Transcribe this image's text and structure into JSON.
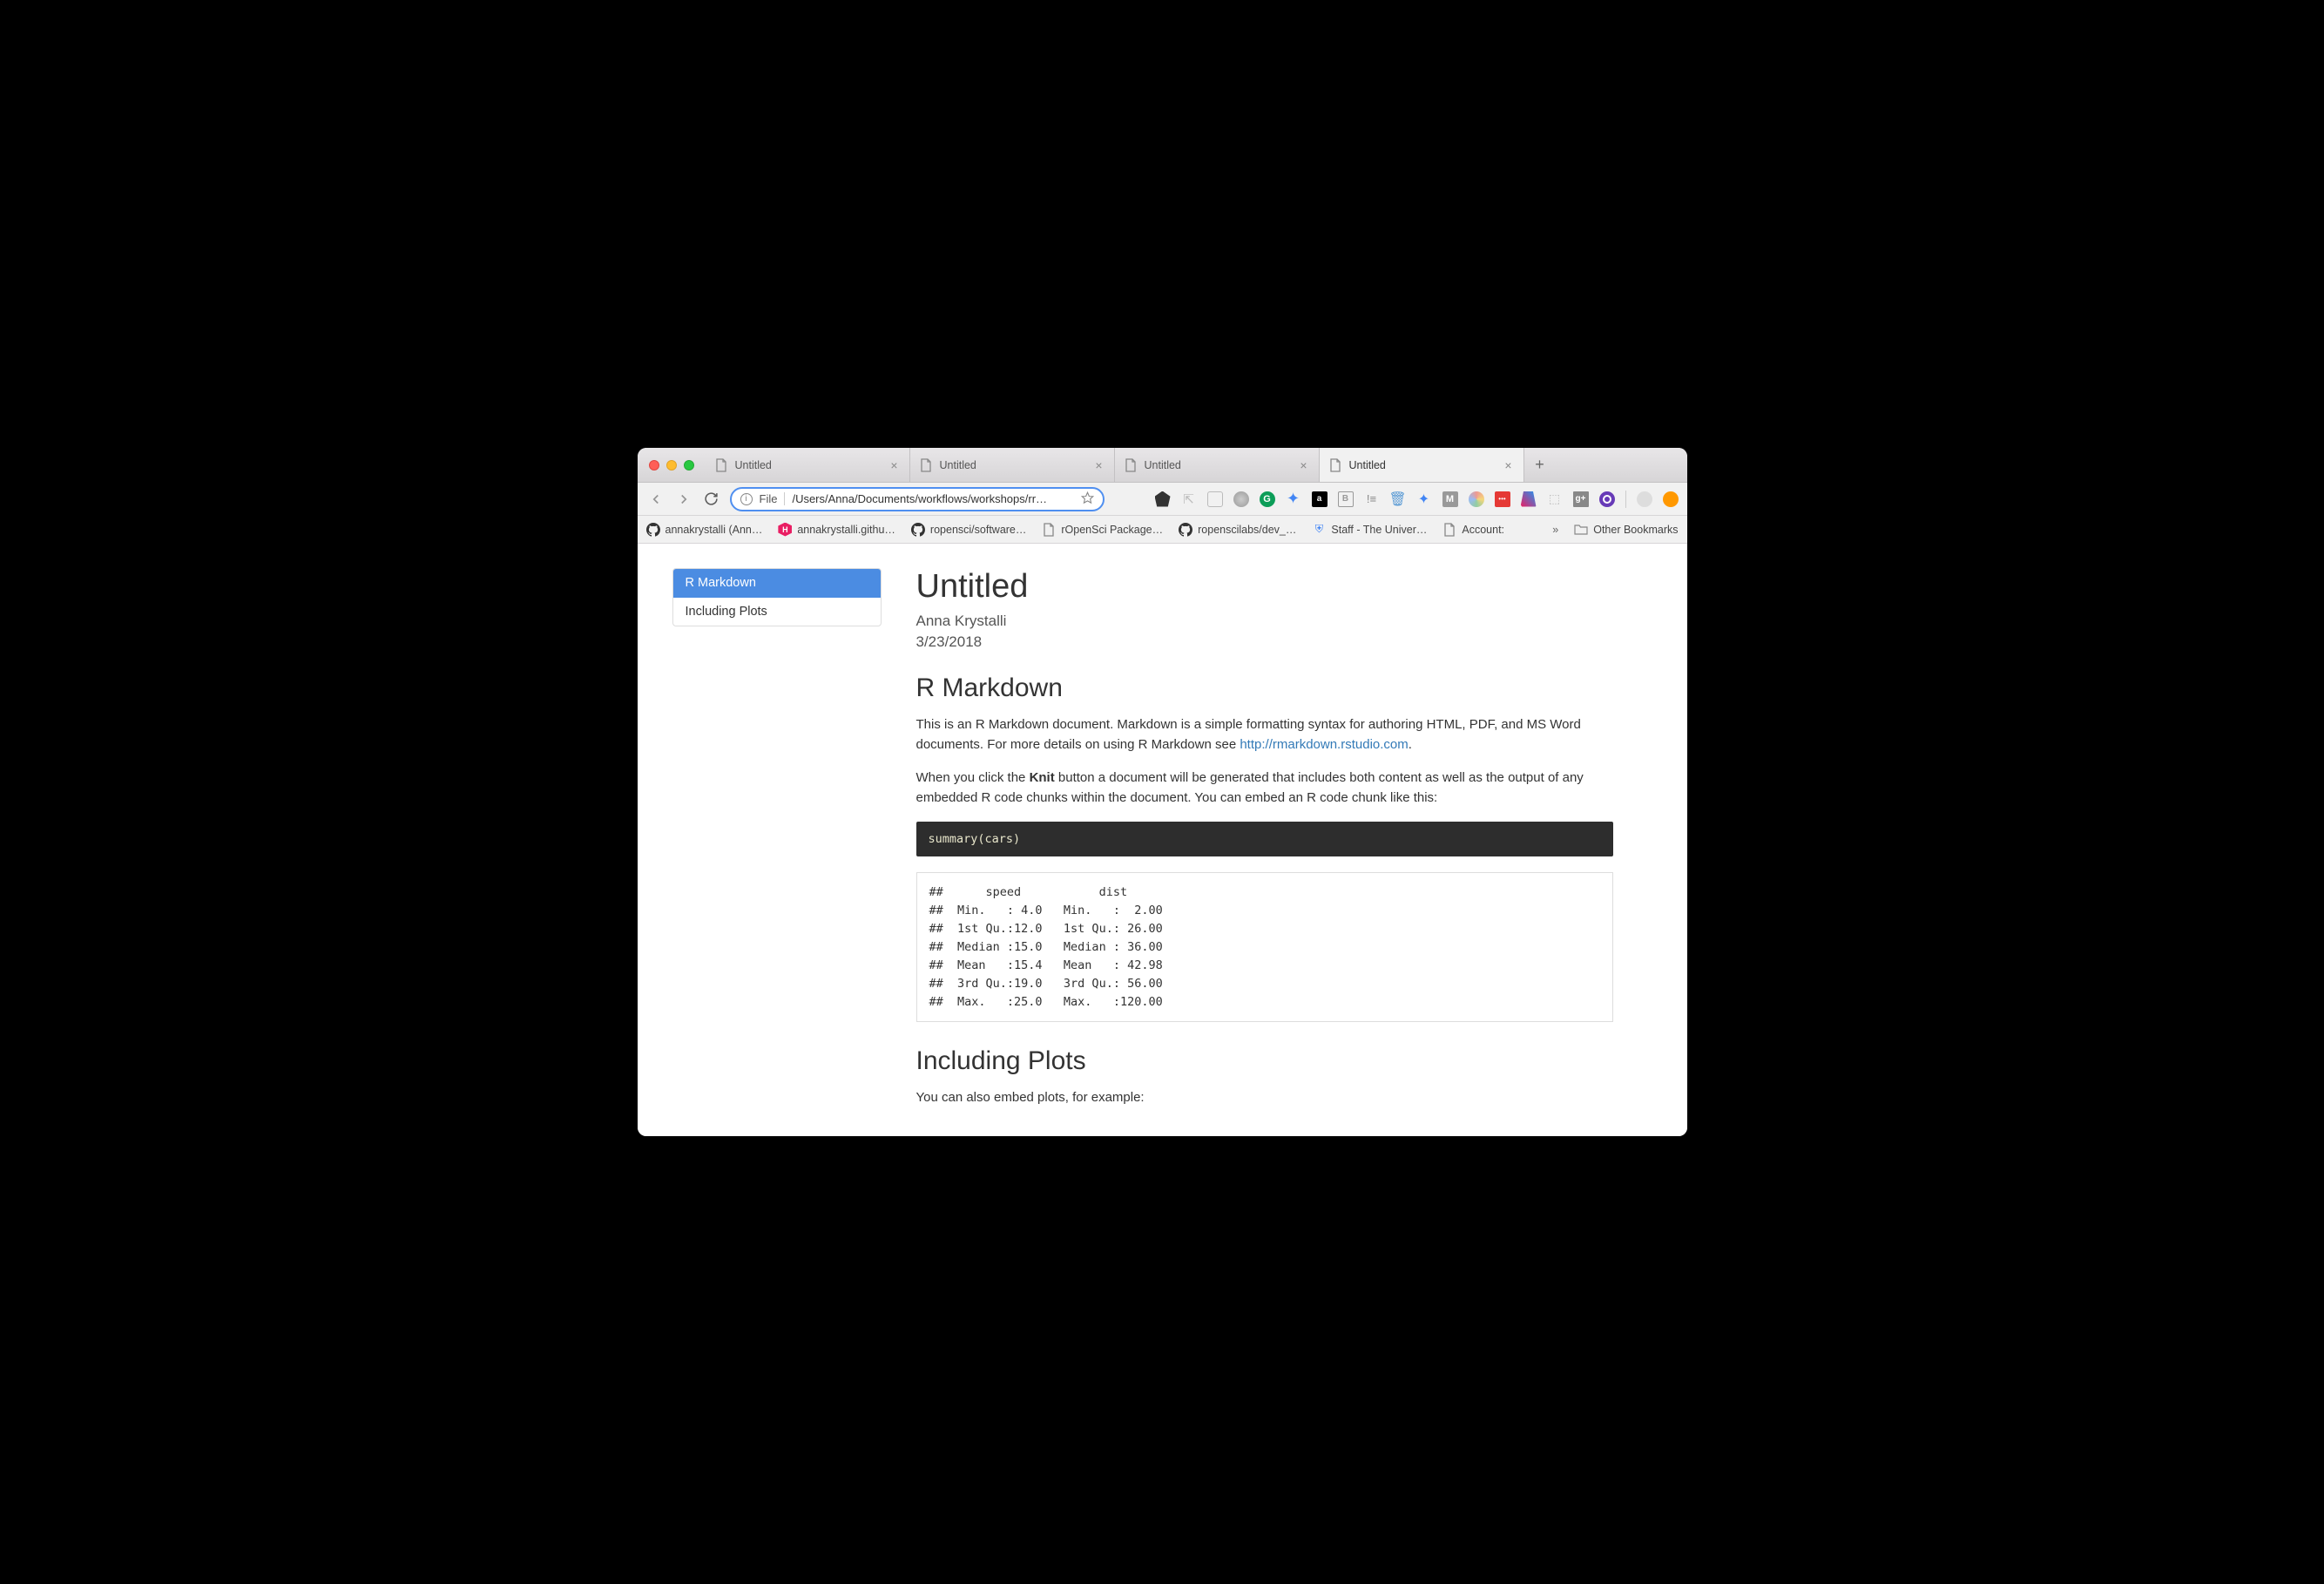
{
  "browser": {
    "tabs": [
      {
        "title": "Untitled",
        "active": false
      },
      {
        "title": "Untitled",
        "active": false
      },
      {
        "title": "Untitled",
        "active": false
      },
      {
        "title": "Untitled",
        "active": true
      }
    ],
    "url_label": "File",
    "url_path": "/Users/Anna/Documents/workflows/workshops/rr…"
  },
  "bookmarks": [
    {
      "label": "annakrystalli (Ann…"
    },
    {
      "label": "annakrystalli.githu…"
    },
    {
      "label": "ropensci/software…"
    },
    {
      "label": "rOpenSci Package…"
    },
    {
      "label": "ropenscilabs/dev_…"
    },
    {
      "label": "Staff - The Univer…"
    },
    {
      "label": "Account:"
    }
  ],
  "other_bookmarks": "Other Bookmarks",
  "toc": [
    {
      "label": "R Markdown",
      "active": true
    },
    {
      "label": "Including Plots",
      "active": false
    }
  ],
  "doc": {
    "title": "Untitled",
    "author": "Anna Krystalli",
    "date": "3/23/2018",
    "h2_rmarkdown": "R Markdown",
    "p1_pre": "This is an R Markdown document. Markdown is a simple formatting syntax for authoring HTML, PDF, and MS Word documents. For more details on using R Markdown see ",
    "p1_link": "http://rmarkdown.rstudio.com",
    "p1_post": ".",
    "p2_pre": "When you click the ",
    "p2_bold": "Knit",
    "p2_post": " button a document will be generated that includes both content as well as the output of any embedded R code chunks within the document. You can embed an R code chunk like this:",
    "code": "summary(cars)",
    "output": "##      speed           dist       \n##  Min.   : 4.0   Min.   :  2.00  \n##  1st Qu.:12.0   1st Qu.: 26.00  \n##  Median :15.0   Median : 36.00  \n##  Mean   :15.4   Mean   : 42.98  \n##  3rd Qu.:19.0   3rd Qu.: 56.00  \n##  Max.   :25.0   Max.   :120.00",
    "h2_plots": "Including Plots",
    "p3": "You can also embed plots, for example:"
  }
}
